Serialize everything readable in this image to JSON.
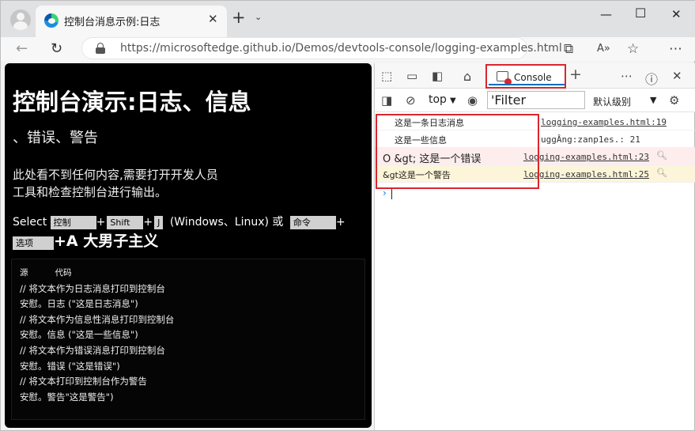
{
  "browser": {
    "tab_title": "控制台消息示例:日志",
    "url": "https://microsoftedge.github.io/Demos/devtools-console/logging-examples.html",
    "icons": [
      "profile-avatar",
      "edge-logo",
      "close-icon",
      "new-tab-icon",
      "tab-dropdown-icon",
      "minimize-icon",
      "maximize-icon",
      "close-window-icon",
      "back-icon",
      "refresh-icon",
      "lock-icon",
      "app-available-icon",
      "read-aloud-icon",
      "favorites-icon",
      "more-icon"
    ]
  },
  "page": {
    "heading": "控制台演示:日志、信息",
    "subheading": "、错误、警告",
    "para_line1": "此处看不到任何内容,需要打开开发人员",
    "para_line2": "工具和检查控制台进行输出。",
    "shortcut": {
      "select": "Select",
      "key_control": "控制",
      "key_shift": "Shift",
      "key_j": "J",
      "platforms": "(Windows、Linux) 或",
      "key_command": "命令",
      "key_option": "选项",
      "tail": "+A 大男子主义"
    },
    "code": {
      "header_source": "源",
      "header_code": "代码",
      "lines": [
        "// 将文本作为日志消息打印到控制台",
        "安慰。日志 (\"这是日志消息\")",
        "// 将文本作为信息性消息打印到控制台",
        "安慰。信息 (\"这是一些信息\")",
        "// 将文本作为错误消息打印到控制台",
        "安慰。错误 (\"这是错误\")",
        "// 将文本打印到控制台作为警告",
        "安慰。警告\"这是警告\")"
      ]
    }
  },
  "devtools": {
    "console_tab": "Console",
    "context": "top",
    "filter_placeholder": "'Filter",
    "levels": "默认级别",
    "messages": [
      {
        "type": "log",
        "text": "这是一条日志消息",
        "source": "logging-examples.html:19"
      },
      {
        "type": "info",
        "text": "这是一些信息",
        "source": "uggÂng:zanp1es.: 21"
      },
      {
        "type": "error",
        "text": "O &gt; 这是一个错误",
        "source": "logging-examples.html:23"
      },
      {
        "type": "warn",
        "text": "&gt这是一个警告",
        "source": "logging-examples.html:25"
      }
    ],
    "accent_error": "#d9262e",
    "accent_tab": "#0f6cbd"
  }
}
